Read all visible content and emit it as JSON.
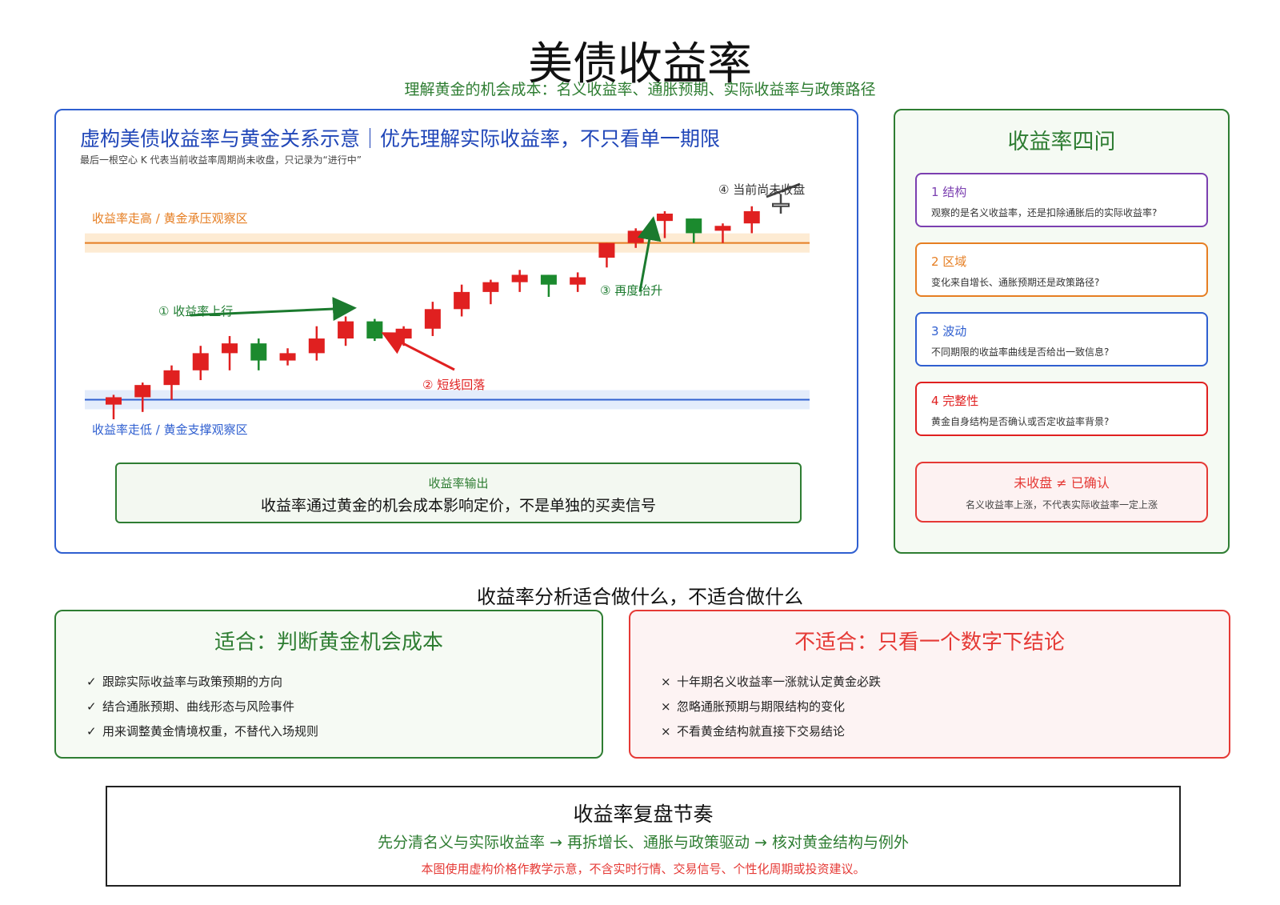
{
  "page": {
    "title": "美债收益率",
    "subtitle": "理解黄金的机会成本：名义收益率、通胀预期、实际收益率与政策路径"
  },
  "chart_panel": {
    "title": "虚构美债收益率与黄金关系示意｜优先理解实际收益率，不只看单一期限",
    "note": "最后一根空心 K 代表当前收益率周期尚未收盘，只记录为“进行中”",
    "upper_zone_label": "收益率走高 / 黄金承压观察区",
    "lower_zone_label": "收益率走低 / 黄金支撑观察区",
    "annotations": {
      "a1": "① 收益率上行",
      "a2": "② 短线回落",
      "a3": "③ 再度抬升",
      "a4": "④ 当前尚未收盘"
    },
    "output_label": "收益率输出",
    "output_text": "收益率通过黄金的机会成本影响定价，不是单独的买卖信号",
    "colors": {
      "up_candle": "#e02020",
      "down_candle": "#1b8a2e",
      "upper_zone": "#e67e22",
      "lower_zone": "#2f5fd0",
      "arrow_up": "#1b7a2e",
      "arrow_down": "#e02020"
    }
  },
  "chart_data": {
    "type": "candlestick",
    "ylim": [
      0,
      100
    ],
    "upper_zone": 72,
    "lower_zone": 8,
    "candles": [
      {
        "o": 6,
        "h": 10,
        "l": 0,
        "c": 9,
        "status": "closed"
      },
      {
        "o": 9,
        "h": 15,
        "l": 3,
        "c": 14,
        "status": "closed"
      },
      {
        "o": 14,
        "h": 22,
        "l": 8,
        "c": 20,
        "status": "closed"
      },
      {
        "o": 20,
        "h": 30,
        "l": 16,
        "c": 27,
        "status": "closed"
      },
      {
        "o": 27,
        "h": 34,
        "l": 20,
        "c": 31,
        "status": "closed"
      },
      {
        "o": 31,
        "h": 33,
        "l": 20,
        "c": 24,
        "status": "closed"
      },
      {
        "o": 24,
        "h": 29,
        "l": 22,
        "c": 27,
        "status": "closed"
      },
      {
        "o": 27,
        "h": 38,
        "l": 24,
        "c": 33,
        "status": "closed"
      },
      {
        "o": 33,
        "h": 42,
        "l": 30,
        "c": 40,
        "status": "closed"
      },
      {
        "o": 40,
        "h": 41,
        "l": 32,
        "c": 33,
        "status": "closed"
      },
      {
        "o": 33,
        "h": 38,
        "l": 30,
        "c": 37,
        "status": "closed"
      },
      {
        "o": 37,
        "h": 48,
        "l": 34,
        "c": 45,
        "status": "closed"
      },
      {
        "o": 45,
        "h": 55,
        "l": 42,
        "c": 52,
        "status": "closed"
      },
      {
        "o": 52,
        "h": 57,
        "l": 47,
        "c": 56,
        "status": "closed"
      },
      {
        "o": 56,
        "h": 61,
        "l": 52,
        "c": 59,
        "status": "closed"
      },
      {
        "o": 59,
        "h": 59,
        "l": 50,
        "c": 55,
        "status": "closed"
      },
      {
        "o": 55,
        "h": 60,
        "l": 52,
        "c": 58,
        "status": "closed"
      },
      {
        "o": 66,
        "h": 72,
        "l": 62,
        "c": 72,
        "status": "closed"
      },
      {
        "o": 72,
        "h": 78,
        "l": 70,
        "c": 77,
        "status": "closed"
      },
      {
        "o": 81,
        "h": 85,
        "l": 74,
        "c": 84,
        "status": "closed"
      },
      {
        "o": 82,
        "h": 82,
        "l": 72,
        "c": 76,
        "status": "closed"
      },
      {
        "o": 77,
        "h": 80,
        "l": 72,
        "c": 79,
        "status": "closed"
      },
      {
        "o": 80,
        "h": 87,
        "l": 76,
        "c": 85,
        "status": "closed"
      },
      {
        "o": 87,
        "h": 92,
        "l": 84,
        "c": 88,
        "status": "open"
      }
    ]
  },
  "questions": {
    "title": "收益率四问",
    "items": [
      {
        "head": "1 结构",
        "body": "观察的是名义收益率，还是扣除通胀后的实际收益率?",
        "color": "#7b3fb0"
      },
      {
        "head": "2 区域",
        "body": "变化来自增长、通胀预期还是政策路径?",
        "color": "#e67e22"
      },
      {
        "head": "3 波动",
        "body": "不同期限的收益率曲线是否给出一致信息?",
        "color": "#2f5fd0"
      },
      {
        "head": "4 完整性",
        "body": "黄金自身结构是否确认或否定收益率背景?",
        "color": "#e02020"
      }
    ],
    "warning_title": "未收盘 ≠ 已确认",
    "warning_text": "名义收益率上涨，不代表实际收益率一定上涨"
  },
  "fit_section": {
    "heading": "收益率分析适合做什么，不适合做什么",
    "fit": {
      "title": "适合：判断黄金机会成本",
      "mark": "✓",
      "items": [
        "跟踪实际收益率与政策预期的方向",
        "结合通胀预期、曲线形态与风险事件",
        "用来调整黄金情境权重，不替代入场规则"
      ]
    },
    "unfit": {
      "title": "不适合：只看一个数字下结论",
      "mark": "×",
      "items": [
        "十年期名义收益率一涨就认定黄金必跌",
        "忽略通胀预期与期限结构的变化",
        "不看黄金结构就直接下交易结论"
      ]
    }
  },
  "review": {
    "title": "收益率复盘节奏",
    "flow": "先分清名义与实际收益率 → 再拆增长、通胀与政策驱动 → 核对黄金结构与例外",
    "disclaimer": "本图使用虚构价格作教学示意，不含实时行情、交易信号、个性化周期或投资建议。"
  }
}
